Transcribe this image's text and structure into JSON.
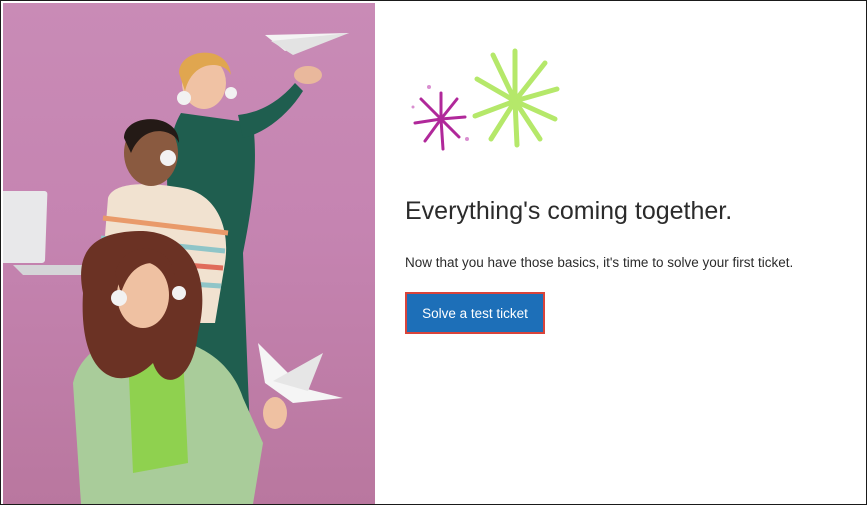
{
  "main": {
    "heading": "Everything's coming together.",
    "body": "Now that you have those basics, it's time to solve your first ticket.",
    "cta_label": "Solve a test ticket"
  },
  "hero": {
    "description_icon": "people-with-headsets-illustration"
  },
  "colors": {
    "hero_background": "#c584b1",
    "button": "#1d6fb8",
    "button_focus_ring": "#d9443b",
    "firework_green": "#b5e86a",
    "firework_magenta": "#b0289a"
  }
}
